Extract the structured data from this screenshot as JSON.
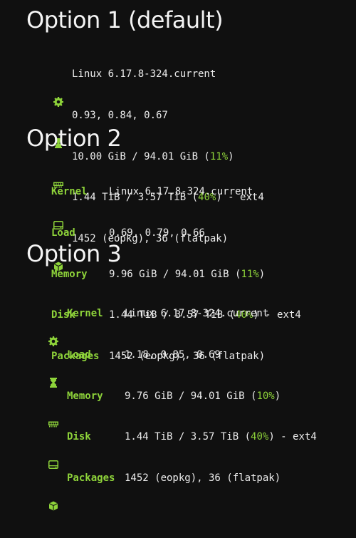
{
  "colors": {
    "background": "#101010",
    "accent": "#8ed33a",
    "text": "#ececec"
  },
  "icons": [
    "gear-icon",
    "hourglass-icon",
    "memory-icon",
    "disk-icon",
    "package-icon"
  ],
  "option1": {
    "title": "Option 1 (default)",
    "kernel": "Linux 6.17.8-324.current",
    "load": "0.93, 0.84, 0.67",
    "memory_a": "10.00 GiB / 94.01 GiB (",
    "memory_pct": "11%",
    "memory_b": ")",
    "disk_a": "1.44 TiB / 3.57 TiB (",
    "disk_pct": "40%",
    "disk_b": ") - ext4",
    "packages": "1452 (eopkg), 36 (flatpak)"
  },
  "option2": {
    "title": "Option 2",
    "labels": {
      "kernel": "Kernel",
      "load": "Load",
      "memory": "Memory",
      "disk": "Disk",
      "packages": "Packages"
    },
    "kernel": "Linux 6.17.8-324.current",
    "load": "0.69, 0.79, 0.66",
    "memory_a": "9.96 GiB / 94.01 GiB (",
    "memory_pct": "11%",
    "memory_b": ")",
    "disk_a": "1.44 TiB / 3.57 TiB (",
    "disk_pct": "40%",
    "disk_b": ") - ext4",
    "packages": "1452 (eopkg), 36 (flatpak)"
  },
  "option3": {
    "title": "Option 3",
    "labels": {
      "kernel": "Kernel",
      "load": "Load",
      "memory": "Memory",
      "disk": "Disk",
      "packages": "Packages"
    },
    "kernel": "Linux 6.17.8-324.current",
    "load": "1.18, 0.85, 0.69",
    "memory_a": "9.76 GiB / 94.01 GiB (",
    "memory_pct": "10%",
    "memory_b": ")",
    "disk_a": "1.44 TiB / 3.57 TiB (",
    "disk_pct": "40%",
    "disk_b": ") - ext4",
    "packages": "1452 (eopkg), 36 (flatpak)"
  }
}
